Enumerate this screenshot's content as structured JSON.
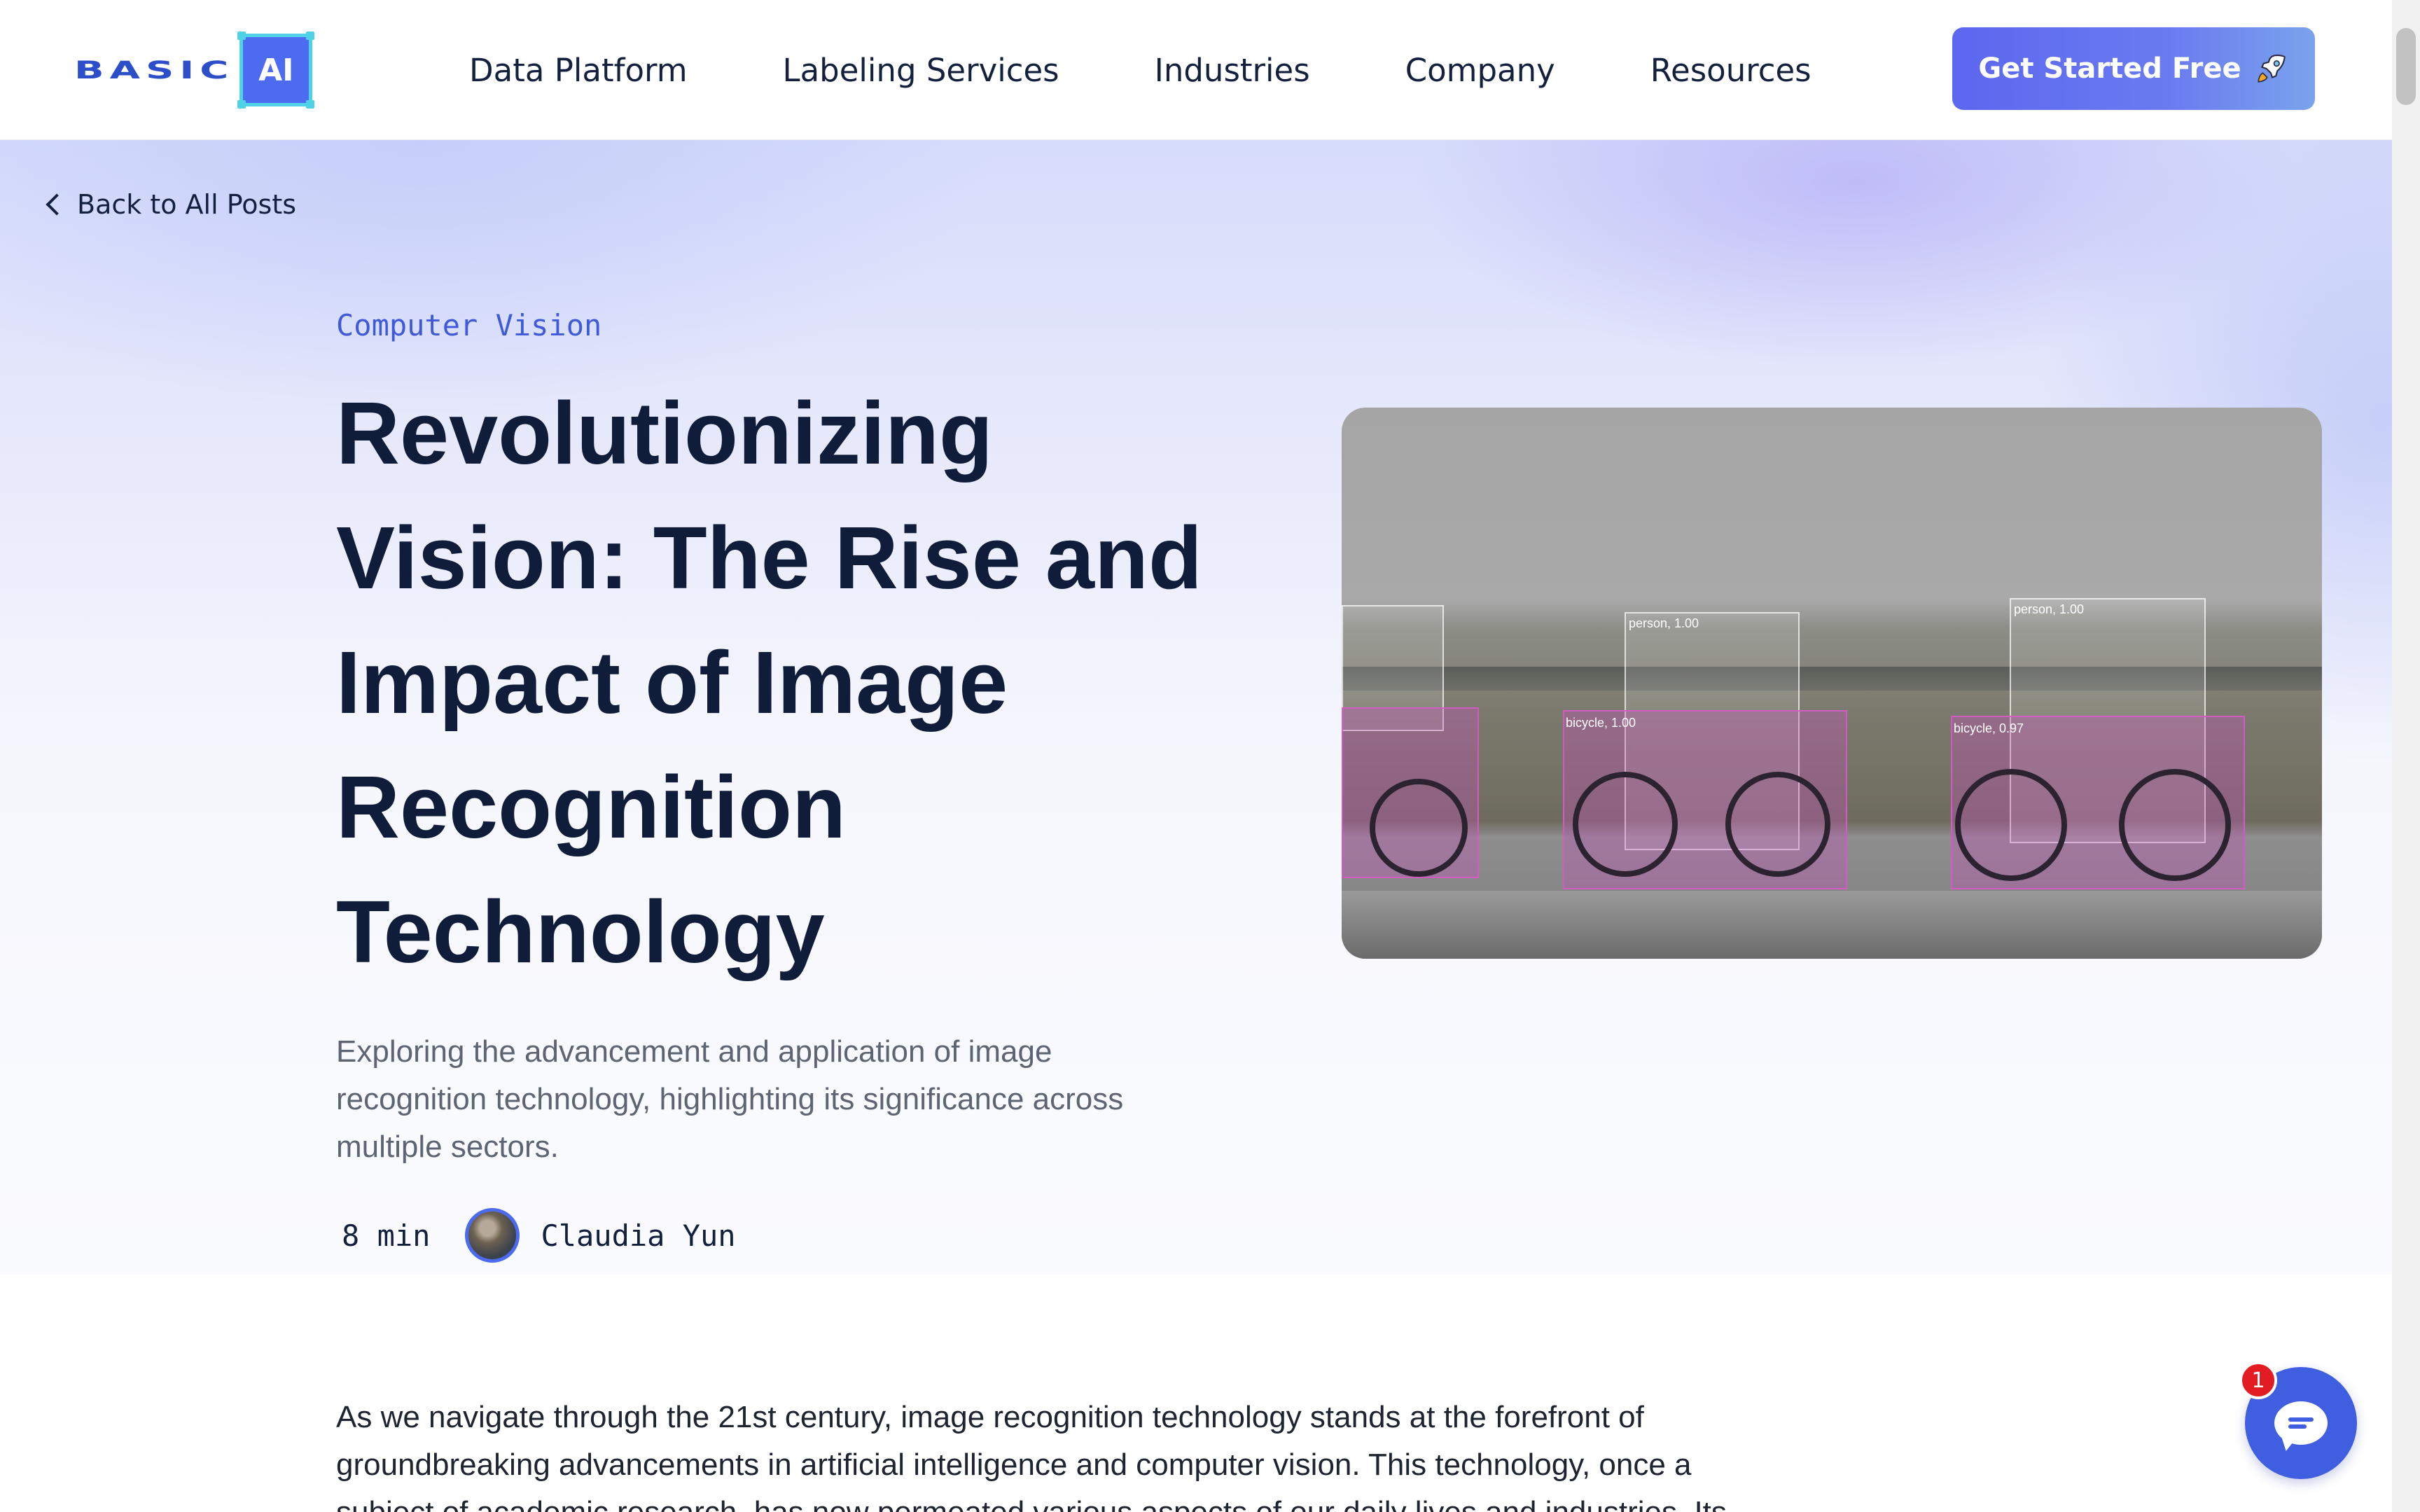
{
  "header": {
    "logo_text": "BASIC",
    "logo_box_text": "AI",
    "nav": [
      {
        "label": "Data Platform"
      },
      {
        "label": "Labeling Services"
      },
      {
        "label": "Industries"
      },
      {
        "label": "Company"
      },
      {
        "label": "Resources"
      }
    ],
    "cta_label": "Get Started Free",
    "cta_icon": "rocket-icon"
  },
  "hero": {
    "back_label": "Back to All Posts",
    "category": "Computer Vision",
    "title": "Revolutionizing Vision: The Rise and Impact of Image Recognition Technology",
    "subtitle": "Exploring the advancement and application of image recognition technology, highlighting its significance across multiple sectors.",
    "read_time": "8 min",
    "author": "Claudia Yun",
    "image_labels": {
      "person_1": "person, 1.00",
      "bicycle_1": "bicycle, 1.00",
      "person_2": "person, 1.00",
      "bicycle_2": "bicycle, 0.97"
    }
  },
  "article": {
    "intro": "As we navigate through the 21st century, image recognition technology stands at the forefront of groundbreaking advancements in artificial intelligence and computer vision. This technology, once a subject of academic research, has now permeated various aspects of our daily lives and industries. Its"
  },
  "chat": {
    "badge_count": "1"
  },
  "colors": {
    "brand": "#4d6bf0",
    "accent": "#3f5ad8",
    "bbox_bike": "#d65ac8",
    "badge": "#e31b23"
  }
}
